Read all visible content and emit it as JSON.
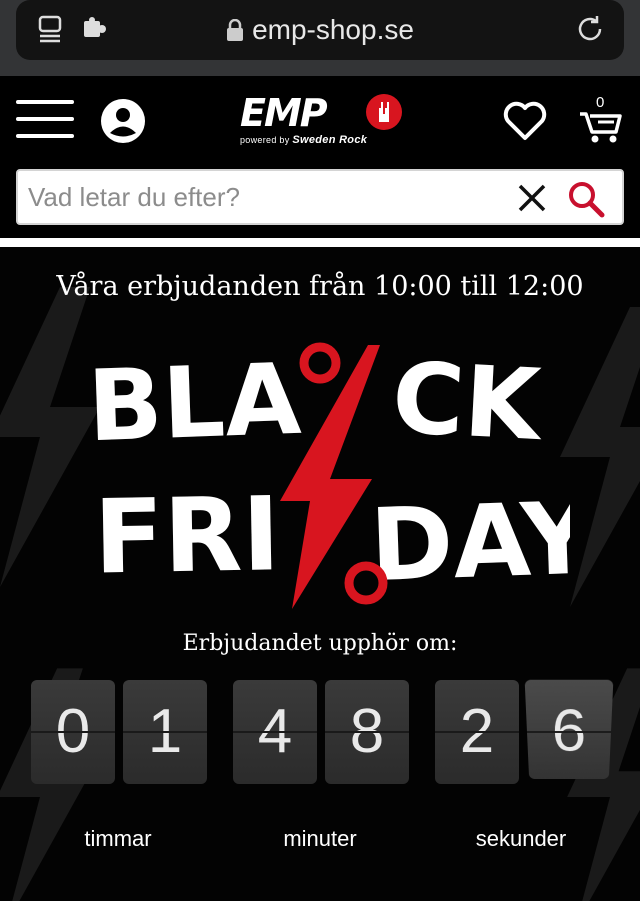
{
  "browser": {
    "url": "emp-shop.se"
  },
  "header": {
    "logo_text": "EMP",
    "logo_tagline_prefix": "powered by",
    "logo_tagline_brand": "Sweden Rock",
    "cart_count": "0",
    "search": {
      "placeholder": "Vad letar du efter?",
      "value": ""
    }
  },
  "hero": {
    "offer_hours": "Våra erbjudanden från 10:00 till 12:00",
    "campaign_line1_left": "BLA",
    "campaign_line1_right": "CK",
    "campaign_line2_left": "FRI",
    "campaign_line2_right": "DAY",
    "countdown_label": "Erbjudandet upphör om:",
    "countdown": {
      "digits": [
        "0",
        "1",
        "4",
        "8",
        "2",
        "6"
      ],
      "units": [
        "timmar",
        "minuter",
        "sekunder"
      ]
    }
  },
  "colors": {
    "brand_red": "#d8151f",
    "background": "#000000",
    "search_icon": "#c8102e"
  },
  "icons": [
    "tabs-icon",
    "extension-icon",
    "lock-icon",
    "reload-icon",
    "menu-icon",
    "account-icon",
    "heart-icon",
    "cart-icon",
    "close-icon",
    "search-icon",
    "lightning-bolt-icon",
    "percent-icon"
  ]
}
